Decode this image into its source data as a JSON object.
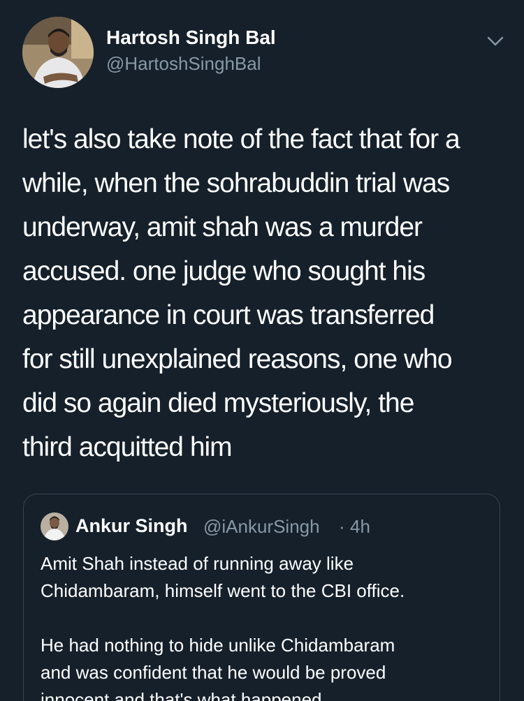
{
  "tweet": {
    "author_name": "Hartosh Singh Bal",
    "author_handle": "@HartoshSinghBal",
    "avatar_icon": "profile-photo-icon",
    "menu_icon": "chevron-down-icon",
    "text": "let's also take note of the fact that for a\nwhile, when the sohrabuddin trial was\nunderway, amit shah was a murder\naccused. one judge who sought his\nappearance in court was transferred\nfor still unexplained reasons, one who\ndid so again died mysteriously, the\nthird acquitted him"
  },
  "quoted_tweet": {
    "author_name": "Ankur Singh",
    "author_handle": "@iAnkurSingh",
    "separator": "·",
    "time": "4h",
    "text": "Amit Shah instead of running away like\nChidambaram, himself went to the CBI office.\n\nHe had nothing to hide unlike Chidambaram\nand was confident that he would be proved\ninnocent and that's what happened"
  },
  "colors": {
    "background": "#15202b",
    "text_primary": "#ffffff",
    "text_secondary": "#8899a6",
    "border": "#38444d"
  }
}
